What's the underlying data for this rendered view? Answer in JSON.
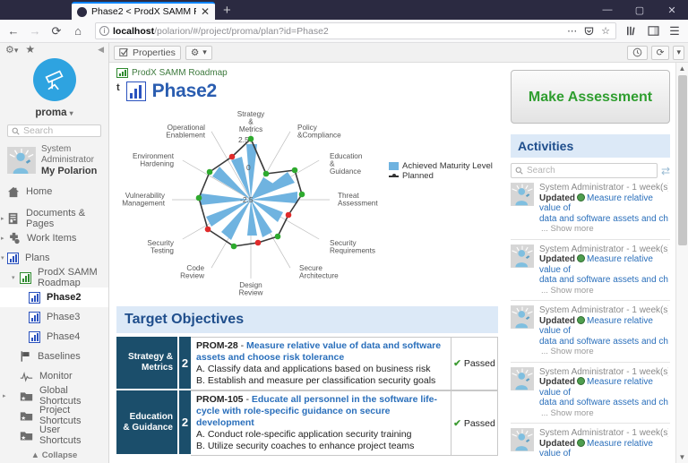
{
  "browser": {
    "tab": {
      "title": "Phase2 < ProdX SAMM Roadm",
      "close": "✕",
      "favicon": "globe-icon"
    },
    "newtab_label": "+",
    "window": {
      "minimize": "—",
      "maximize": "▢",
      "close": "✕"
    },
    "nav": {
      "back": "←",
      "forward": "→",
      "reload": "⟳",
      "home": "⌂"
    },
    "url": {
      "host": "localhost",
      "path": "/polarion/#/project/proma/plan?id=Phase2",
      "info_icon": "info-icon"
    },
    "url_actions": {
      "more": "⋯",
      "pocket": "pocket-icon",
      "bookmark": "☆"
    },
    "toolbar_right": {
      "library": "library-icon",
      "sidebar": "sidebar-icon",
      "menu": "☰"
    }
  },
  "sidebar": {
    "top_icons": {
      "settings": "gear-icon",
      "favorite": "star-icon",
      "collapse": "◀"
    },
    "logo": "telescope-icon",
    "project": "proma",
    "project_caret": "▾",
    "search_placeholder": "Search",
    "user": {
      "name_line1": "System",
      "name_line2": "Administrator",
      "link": "My Polarion",
      "avatar": "user-avatar"
    },
    "items": [
      {
        "label": "Home",
        "icon": "home-icon",
        "twisty": ""
      },
      {
        "label": "Documents & Pages",
        "icon": "documents-icon",
        "twisty": "▸"
      },
      {
        "label": "Work Items",
        "icon": "workitems-icon",
        "twisty": "▸"
      },
      {
        "label": "Plans",
        "icon": "plans-icon",
        "twisty": "▾"
      },
      {
        "label": "ProdX SAMM Roadmap",
        "icon": "plan-green-icon",
        "twisty": "▾"
      },
      {
        "label": "Phase2",
        "icon": "plan-blue-icon",
        "twisty": ""
      },
      {
        "label": "Phase3",
        "icon": "plan-blue-icon",
        "twisty": ""
      },
      {
        "label": "Phase4",
        "icon": "plan-blue-icon",
        "twisty": ""
      },
      {
        "label": "Baselines",
        "icon": "flag-icon",
        "twisty": ""
      },
      {
        "label": "Monitor",
        "icon": "monitor-icon",
        "twisty": ""
      },
      {
        "label": "Global Shortcuts",
        "icon": "folder-star-icon",
        "twisty": "▸"
      },
      {
        "label": "Project Shortcuts",
        "icon": "folder-star-icon",
        "twisty": ""
      },
      {
        "label": "User Shortcuts",
        "icon": "folder-star-icon",
        "twisty": ""
      }
    ],
    "collapse_label": "▲ Collapse"
  },
  "toolbar": {
    "properties_label": "Properties",
    "properties_icon": "checkbox-edit-icon",
    "gear_icon": "gear-icon",
    "gear_caret": "▾",
    "history_icon": "clock-icon",
    "refresh_icon": "⟳",
    "refresh_caret": "▾"
  },
  "page": {
    "breadcrumb": "ProdX SAMM Roadmap",
    "breadcrumb_icon": "plan-green-icon",
    "title_superscript": "t",
    "title": "Phase2",
    "title_icon": "plan-blue-icon"
  },
  "chart_data": {
    "type": "radar",
    "title": "",
    "legend_position": "right",
    "legend": [
      {
        "name": "Achieved Maturity Level",
        "color": "#6fb3e0",
        "marker": "area"
      },
      {
        "name": "Planned",
        "color": "#333333",
        "marker": "line"
      }
    ],
    "tick_labels": [
      "2.5",
      "0",
      "-2.5"
    ],
    "rlim": [
      0,
      3
    ],
    "categories": [
      "Strategy & Metrics",
      "Policy &Compliance",
      "Education & Guidance",
      "Threat Assessment",
      "Security Requirements",
      "Secure Architecture",
      "Design Review",
      "Code Review",
      "Security Testing",
      "Vulnerability Management",
      "Environment Hardening",
      "Operational Enablement"
    ],
    "series": [
      {
        "name": "Achieved Maturity Level",
        "color": "#6fb3e0",
        "values": [
          2.5,
          1.0,
          2.2,
          2.0,
          1.6,
          1.8,
          1.5,
          2.0,
          1.9,
          2.1,
          1.9,
          1.6
        ]
      },
      {
        "name": "Planned",
        "color": "#333333",
        "values": [
          2.5,
          1.0,
          2.2,
          2.0,
          1.6,
          1.8,
          1.5,
          2.0,
          1.9,
          2.1,
          1.9,
          1.6
        ],
        "point_status": [
          "green",
          "green",
          "green",
          "green",
          "red",
          "green",
          "red",
          "green",
          "red",
          "green",
          "green",
          "red"
        ]
      }
    ],
    "point_colors": {
      "green": "#2eaa2e",
      "red": "#e02b2b"
    }
  },
  "target_objectives": {
    "header": "Target Objectives",
    "rows": [
      {
        "category": "Strategy & Metrics",
        "level": "2",
        "id": "PROM-28",
        "dash": "-",
        "title": "Measure relative value of data and software assets and choose risk tolerance",
        "bullets": [
          "A. Classify data and applications based on business risk",
          "B. Establish and measure per classification security goals"
        ],
        "status": "Passed",
        "status_icon": "✔"
      },
      {
        "category": "Education & Guidance",
        "level": "2",
        "id": "PROM-105",
        "dash": "-",
        "title": "Educate all personnel in the software life-cycle with role-specific guidance on secure development",
        "bullets": [
          "A. Conduct role-specific application security training",
          "B. Utilize security coaches to enhance project teams"
        ],
        "status": "Passed",
        "status_icon": "✔"
      }
    ]
  },
  "rail": {
    "assess_button": "Make Assessment",
    "activities_header": "Activities",
    "search_placeholder": "Search",
    "search_icon": "search-icon",
    "refresh_icon": "refresh-icon",
    "activities": [
      {
        "who": "System Administrator - 1 week(s) ago",
        "action": "Updated",
        "item": "Measure relative value of",
        "item_cont": "data and software assets and choose ris",
        "more": "... Show more"
      },
      {
        "who": "System Administrator - 1 week(s) ago",
        "action": "Updated",
        "item": "Measure relative value of",
        "item_cont": "data and software assets and choose ris",
        "more": "... Show more"
      },
      {
        "who": "System Administrator - 1 week(s) ago",
        "action": "Updated",
        "item": "Measure relative value of",
        "item_cont": "data and software assets and choose ris",
        "more": "... Show more"
      },
      {
        "who": "System Administrator - 1 week(s) ago",
        "action": "Updated",
        "item": "Measure relative value of",
        "item_cont": "data and software assets and choose ris",
        "more": "... Show more"
      },
      {
        "who": "System Administrator - 1 week(s) ago",
        "action": "Updated",
        "item": "Measure relative value of",
        "item_cont": "",
        "more": ""
      }
    ]
  },
  "scrollbar": {
    "up": "▲",
    "down": "▼"
  },
  "colors": {
    "accent_blue": "#2a5db0",
    "panel_header_bg": "#dce9f7",
    "table_dark": "#1b4e6b",
    "green": "#2f9e2f",
    "chart_fill": "#6fb3e0"
  }
}
